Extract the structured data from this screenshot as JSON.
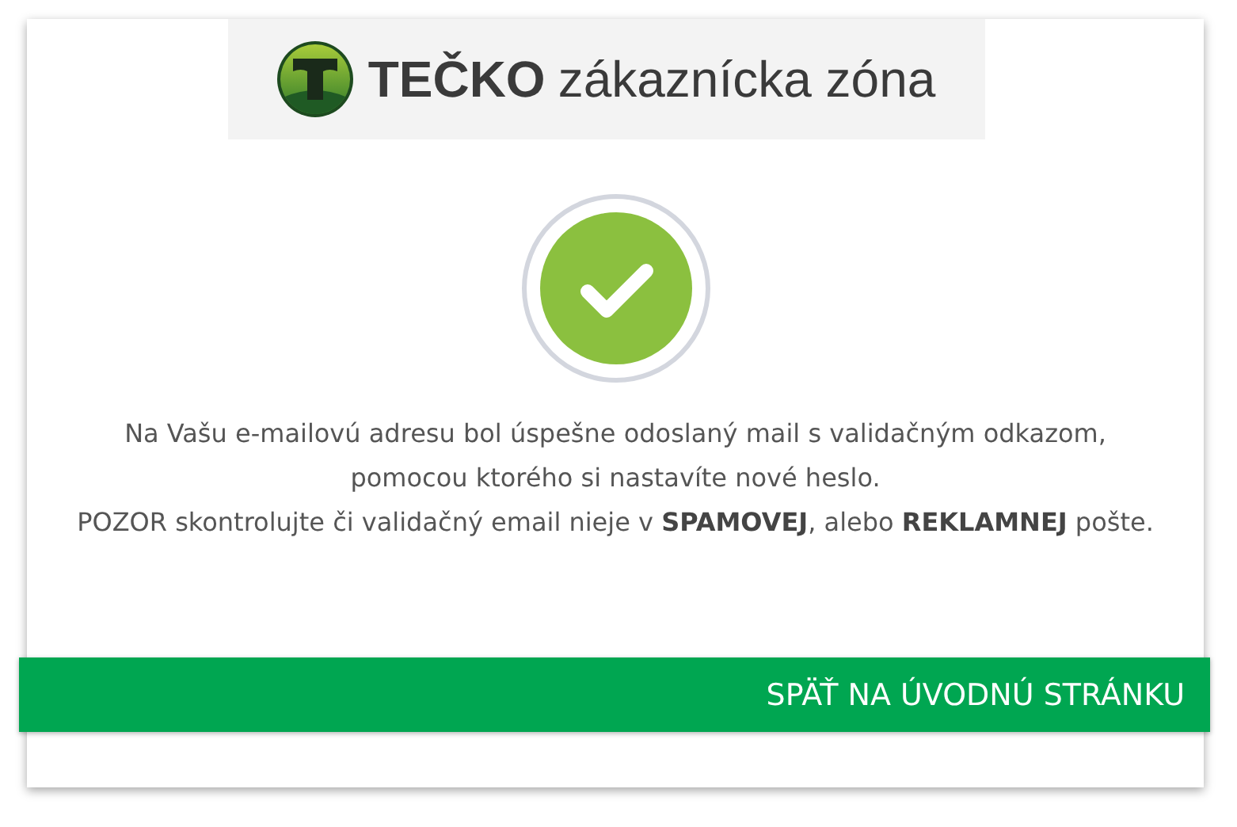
{
  "logo": {
    "brand": "TEČKO",
    "subtitle": "zákaznícka zóna"
  },
  "status": {
    "kind": "success"
  },
  "message": [
    "Na Vašu e-mailovú adresu bol úspešne odoslaný mail s validačným odkazom, pomocou ktorého si nastavíte nové heslo.",
    "POZOR skontrolujte či validačný email nieje v **SPAMOVEJ**, alebo **REKLAMNEJ** pošte."
  ],
  "button": {
    "label": "SPÄŤ NA ÚVODNÚ STRÁNKU"
  }
}
